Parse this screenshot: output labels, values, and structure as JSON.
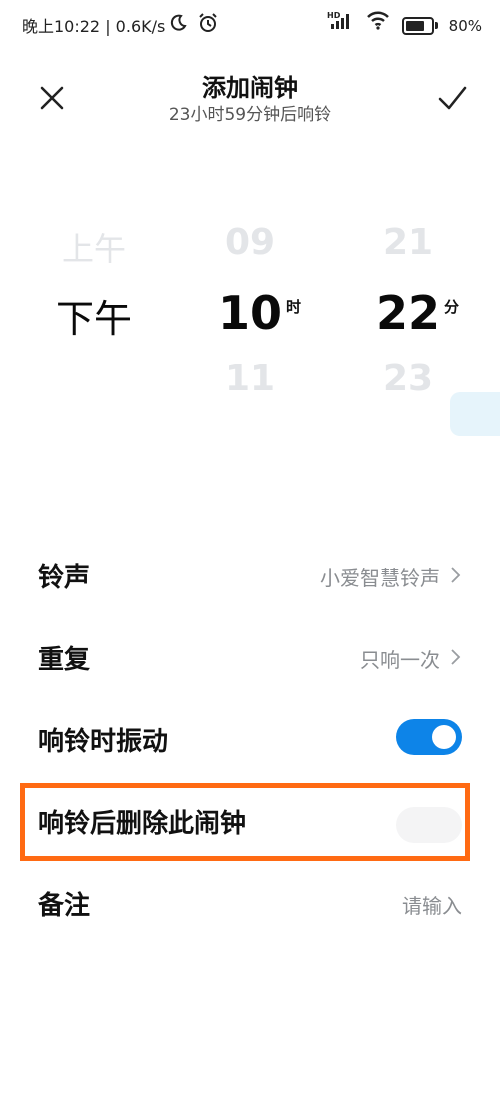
{
  "status_bar": {
    "left_text": "晚上10:22 | 0.6K/s",
    "battery_percent": "80%",
    "icons": [
      "moon-icon",
      "alarm-clock-icon",
      "hd-signal-icon",
      "wifi-icon",
      "battery-icon"
    ]
  },
  "header": {
    "title": "添加闹钟",
    "subtitle": "23小时59分钟后响铃",
    "close_icon": "close-icon",
    "confirm_icon": "check-icon"
  },
  "picker": {
    "ampm": {
      "prev": "上午",
      "current": "下午"
    },
    "hour": {
      "prev": "09",
      "current": "10",
      "next": "11",
      "unit": "时"
    },
    "minute": {
      "prev": "21",
      "current": "22",
      "next": "23",
      "unit": "分"
    }
  },
  "settings": {
    "ringtone": {
      "label": "铃声",
      "value": "小爱智慧铃声"
    },
    "repeat": {
      "label": "重复",
      "value": "只响一次"
    },
    "vibrate": {
      "label": "响铃时振动",
      "on": true
    },
    "delete_after": {
      "label": "响铃后删除此闹钟",
      "on": false
    },
    "note": {
      "label": "备注",
      "placeholder": "请输入"
    }
  },
  "colors": {
    "accent": "#0d84e8",
    "highlight": "#ff6a13"
  }
}
